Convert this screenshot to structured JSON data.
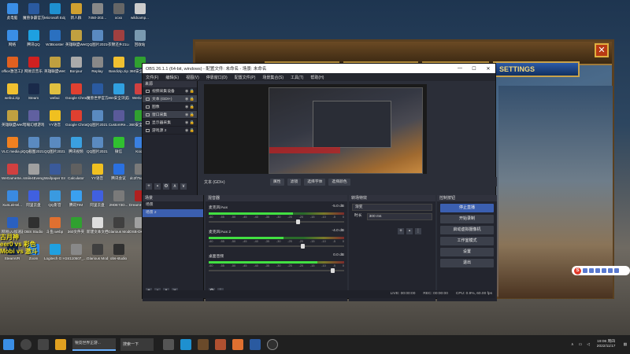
{
  "desktop": {
    "icons": [
      {
        "label": "此电脑",
        "color": "#3a8ee6"
      },
      {
        "label": "魔兽争霸官方对战平台",
        "color": "#2a5aa0"
      },
      {
        "label": "Microsoft Edge",
        "color": "#1e90d0"
      },
      {
        "label": "新人群",
        "color": "#d0a030"
      },
      {
        "label": "7450-202...",
        "color": "#888888"
      },
      {
        "label": "xcxx",
        "color": "#666666"
      },
      {
        "label": "wildcamp...",
        "color": "#cccccc"
      },
      {
        "label": "网络",
        "color": "#3a8ee6"
      },
      {
        "label": "腾讯QQ",
        "color": "#1ea0e0"
      },
      {
        "label": "W3Booster",
        "color": "#2a70c0"
      },
      {
        "label": "英雄联盟WeGame版",
        "color": "#c0a040"
      },
      {
        "label": "QQ图片20210621...",
        "color": "#5a8ac0"
      },
      {
        "label": "衣锦还乡21Love",
        "color": "#a04040"
      },
      {
        "label": "回收站",
        "color": "#7a9ab0"
      },
      {
        "label": "office激活工具",
        "color": "#e06020"
      },
      {
        "label": "网易云音乐",
        "color": "#d02020"
      },
      {
        "label": "英雄联盟WeGame版",
        "color": "#c0a040"
      },
      {
        "label": "Bonjour",
        "color": "#aaaaaa"
      },
      {
        "label": "Replay",
        "color": "#888888"
      },
      {
        "label": "Bandizip.zip",
        "color": "#f0c030"
      },
      {
        "label": "360安全卫士",
        "color": "#30a030"
      },
      {
        "label": "webui.zip",
        "color": "#f0c030"
      },
      {
        "label": "Steam",
        "color": "#1a2a4a"
      },
      {
        "label": "webui",
        "color": "#e0c040"
      },
      {
        "label": "Google Chrome",
        "color": "#e04030"
      },
      {
        "label": "魔兽世界官方对战平台",
        "color": "#2a5aa0"
      },
      {
        "label": "360安全浏览器",
        "color": "#30a0e0"
      },
      {
        "label": "WeGame",
        "color": "#d04040"
      },
      {
        "label": "英雄联盟WeGame版",
        "color": "#c0a040"
      },
      {
        "label": "暗喻幻想游戏",
        "color": "#6060a0"
      },
      {
        "label": "YY语音",
        "color": "#f0c020"
      },
      {
        "label": "Google Chrome",
        "color": "#e04030"
      },
      {
        "label": "QQ图片2021...",
        "color": "#5a8ac0"
      },
      {
        "label": "CustomRe...",
        "color": "#5a5a9a"
      },
      {
        "label": "360安全卫士游戏",
        "color": "#30a030"
      },
      {
        "label": "VLC media player",
        "color": "#f08020"
      },
      {
        "label": "QQ截图2021...",
        "color": "#5a8ac0"
      },
      {
        "label": "QQ图片2021...",
        "color": "#5a8ac0"
      },
      {
        "label": "腾讯视频",
        "color": "#3aa0e0"
      },
      {
        "label": "QQ图片2021...",
        "color": "#5a8ac0"
      },
      {
        "label": "微信",
        "color": "#30c030"
      },
      {
        "label": "Kook",
        "color": "#3a80e0"
      },
      {
        "label": "WeGameSe...",
        "color": "#d04040"
      },
      {
        "label": "smile4Eveng",
        "color": "#a0a0a0"
      },
      {
        "label": "Wallpaper Engine",
        "color": "#3a5a9a"
      },
      {
        "label": "Calculator",
        "color": "#606060"
      },
      {
        "label": "YY语音",
        "color": "#f0c020"
      },
      {
        "label": "腾讯会议",
        "color": "#2a70e0"
      },
      {
        "label": "dc2f75d5e...",
        "color": "#7a7a7a"
      },
      {
        "label": "XunLeiHel...",
        "color": "#3a8ae0"
      },
      {
        "label": "阿里云盘",
        "color": "#4060e0"
      },
      {
        "label": "QQ影音",
        "color": "#3a9ae0"
      },
      {
        "label": "腾讯TIM",
        "color": "#3aa0f0"
      },
      {
        "label": "阿里云盘",
        "color": "#4060e0"
      },
      {
        "label": "29DE73D...",
        "color": "#7a7a7a"
      },
      {
        "label": "DreamHack WCG Opera",
        "color": "#b02020"
      },
      {
        "label": "网易UU加速器",
        "color": "#2a60c0"
      },
      {
        "label": "OBS Studio",
        "color": "#303030"
      },
      {
        "label": "斗鱼.webp",
        "color": "#e07030"
      },
      {
        "label": "360文件夹",
        "color": "#30a030"
      },
      {
        "label": "新建文本文档.txt",
        "color": "#dddddd"
      },
      {
        "label": "Glarious Model O...",
        "color": "#404040"
      },
      {
        "label": "OSB-DK_basic",
        "color": "#a0a0a0"
      },
      {
        "label": "SteamVR",
        "color": "#1a2a4a"
      },
      {
        "label": "Zoom",
        "color": "#2a8af0"
      },
      {
        "label": "Logitech G HUB",
        "color": "#20a0e0"
      },
      {
        "label": "24110507_...",
        "color": "#888888"
      },
      {
        "label": "Glarious Model O...",
        "color": "#404040"
      },
      {
        "label": "obs-studio",
        "color": "#303030"
      }
    ],
    "overlay_text": [
      "古月神",
      "eer0 vs 彩色",
      "Mobi vs 激斗"
    ]
  },
  "game_window": {
    "settings_tab": "SETTINGS",
    "close_label": "✕"
  },
  "obs": {
    "title": "OBS 26.1.1 (64-bit, windows) - 配置文件: 未命名 - 场景: 未命名",
    "controls": {
      "minimize": "—",
      "maximize": "☐",
      "close": "✕"
    },
    "menu": [
      "文件(F)",
      "编辑(E)",
      "视图(V)",
      "停靠窗口(D)",
      "配置文件(P)",
      "场景集合(S)",
      "工具(T)",
      "帮助(H)"
    ],
    "sources": {
      "header": "来源",
      "items": [
        {
          "label": "视频采集设备",
          "selected": false
        },
        {
          "label": "文本 (GDI+)",
          "selected": true
        },
        {
          "label": "图像",
          "selected": false
        },
        {
          "label": "窗口采集",
          "selected": true
        },
        {
          "label": "显示器采集",
          "selected": false
        },
        {
          "label": "游戏源 2",
          "selected": false
        }
      ]
    },
    "source_toolbar": {
      "label": "文本 (GDI+)",
      "buttons": [
        "属性",
        "滤镜",
        "选择字体",
        "选择颜色"
      ]
    },
    "scenes": {
      "header": "场景",
      "items": [
        {
          "label": "场景",
          "selected": false
        },
        {
          "label": "场景 2",
          "selected": true
        }
      ]
    },
    "mixer": {
      "header": "混音器",
      "tracks": [
        {
          "name": "麦克风/Aux",
          "db": "-5.0 dB",
          "level": 0.62,
          "volume": 0.66
        },
        {
          "name": "麦克风/Aux 2",
          "db": "-4.0 dB",
          "level": 0.55,
          "volume": 0.7
        },
        {
          "name": "桌面音频",
          "db": "0.0 dB",
          "level": 0.8,
          "volume": 0.92
        }
      ],
      "ticks": [
        "-60",
        "-55",
        "-50",
        "-45",
        "-40",
        "-35",
        "-30",
        "-25",
        "-20",
        "-15",
        "-10",
        "-5",
        "0"
      ]
    },
    "transitions": {
      "header": "转场特效",
      "type": "渐变",
      "duration_label": "时长",
      "duration": "300 ms"
    },
    "controls_panel": {
      "header": "控制按钮",
      "buttons": [
        "停止直播",
        "开始录制",
        "启动虚拟摄像机",
        "工作室模式",
        "设置",
        "退出"
      ]
    },
    "status": {
      "live": "LIVE: 00:00:00",
      "rec": "REC: 00:00:00",
      "cpu": "CPU: 0.9%, 60.00 fps"
    }
  },
  "taskbar": {
    "search_placeholder": "搜索一下",
    "active_app": "锐竞世界正游...",
    "time": "19:06 周四",
    "date": "2022/11/17"
  },
  "ime": {
    "logo": "S"
  }
}
